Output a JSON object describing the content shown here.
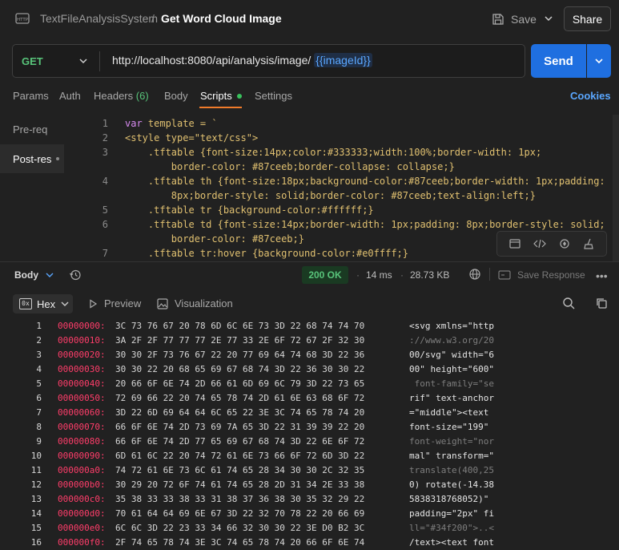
{
  "header": {
    "breadcrumb_parent": "TextFileAnalysisSystem",
    "breadcrumb_sep": "/",
    "title": "Get Word Cloud Image",
    "save_label": "Save",
    "share_label": "Share",
    "app_icon": "http-icon"
  },
  "request": {
    "method": "GET",
    "url": "http://localhost:8080/api/analysis/image/",
    "url_variable": "{{imageId}}",
    "send_label": "Send"
  },
  "tabs": {
    "params": "Params",
    "auth": "Auth",
    "headers": "Headers",
    "headers_count": "(6)",
    "body": "Body",
    "scripts": "Scripts",
    "settings": "Settings",
    "cookies": "Cookies"
  },
  "scripts": {
    "pre_request": "Pre-req",
    "post_response": "Post-res",
    "lines": [
      {
        "n": "1",
        "pre": "var",
        "text": " template = `"
      },
      {
        "n": "2",
        "pre": "",
        "text": "<style type=\"text/css\">"
      },
      {
        "n": "3",
        "pre": "",
        "text": "    .tftable {font-size:14px;color:#333333;width:100%;border-width: 1px;"
      },
      {
        "n": "",
        "pre": "",
        "text": "        border-color: #87ceeb;border-collapse: collapse;}"
      },
      {
        "n": "4",
        "pre": "",
        "text": "    .tftable th {font-size:18px;background-color:#87ceeb;border-width: 1px;padding:"
      },
      {
        "n": "",
        "pre": "",
        "text": "        8px;border-style: solid;border-color: #87ceeb;text-align:left;}"
      },
      {
        "n": "5",
        "pre": "",
        "text": "    .tftable tr {background-color:#ffffff;}"
      },
      {
        "n": "6",
        "pre": "",
        "text": "    .tftable td {font-size:14px;border-width: 1px;padding: 8px;border-style: solid;"
      },
      {
        "n": "",
        "pre": "",
        "text": "        border-color: #87ceeb;}"
      },
      {
        "n": "7",
        "pre": "",
        "text": "    .tftable tr:hover {background-color:#e0ffff;}"
      }
    ]
  },
  "response": {
    "body_label": "Body",
    "status": "200 OK",
    "time": "14 ms",
    "size": "28.73 KB",
    "save_response": "Save Response",
    "format": "Hex",
    "preview": "Preview",
    "visualization": "Visualization",
    "rows": [
      {
        "n": "1",
        "addr": "00000000:",
        "bytes": "3C 73 76 67 20 78 6D 6C 6E 73 3D 22 68 74 74 70",
        "ascii": "<svg xmlns=\"http",
        "dim": false
      },
      {
        "n": "2",
        "addr": "00000010:",
        "bytes": "3A 2F 2F 77 77 77 2E 77 33 2E 6F 72 67 2F 32 30",
        "ascii": "://www.w3.org/20",
        "dim": true
      },
      {
        "n": "3",
        "addr": "00000020:",
        "bytes": "30 30 2F 73 76 67 22 20 77 69 64 74 68 3D 22 36",
        "ascii": "00/svg\" width=\"6",
        "dim": false
      },
      {
        "n": "4",
        "addr": "00000030:",
        "bytes": "30 30 22 20 68 65 69 67 68 74 3D 22 36 30 30 22",
        "ascii": "00\" height=\"600\"",
        "dim": false
      },
      {
        "n": "5",
        "addr": "00000040:",
        "bytes": "20 66 6F 6E 74 2D 66 61 6D 69 6C 79 3D 22 73 65",
        "ascii": " font-family=\"se",
        "dim": true
      },
      {
        "n": "6",
        "addr": "00000050:",
        "bytes": "72 69 66 22 20 74 65 78 74 2D 61 6E 63 68 6F 72",
        "ascii": "rif\" text-anchor",
        "dim": false
      },
      {
        "n": "7",
        "addr": "00000060:",
        "bytes": "3D 22 6D 69 64 64 6C 65 22 3E 3C 74 65 78 74 20",
        "ascii": "=\"middle\"><text",
        "dim": false
      },
      {
        "n": "8",
        "addr": "00000070:",
        "bytes": "66 6F 6E 74 2D 73 69 7A 65 3D 22 31 39 39 22 20",
        "ascii": "font-size=\"199\"",
        "dim": false
      },
      {
        "n": "9",
        "addr": "00000080:",
        "bytes": "66 6F 6E 74 2D 77 65 69 67 68 74 3D 22 6E 6F 72",
        "ascii": "font-weight=\"nor",
        "dim": true
      },
      {
        "n": "10",
        "addr": "00000090:",
        "bytes": "6D 61 6C 22 20 74 72 61 6E 73 66 6F 72 6D 3D 22",
        "ascii": "mal\" transform=\"",
        "dim": false
      },
      {
        "n": "11",
        "addr": "000000a0:",
        "bytes": "74 72 61 6E 73 6C 61 74 65 28 34 30 30 2C 32 35",
        "ascii": "translate(400,25",
        "dim": true
      },
      {
        "n": "12",
        "addr": "000000b0:",
        "bytes": "30 29 20 72 6F 74 61 74 65 28 2D 31 34 2E 33 38",
        "ascii": "0) rotate(-14.38",
        "dim": false
      },
      {
        "n": "13",
        "addr": "000000c0:",
        "bytes": "35 38 33 33 38 33 31 38 37 36 38 30 35 32 29 22",
        "ascii": "5838318768052)\"",
        "dim": false
      },
      {
        "n": "14",
        "addr": "000000d0:",
        "bytes": "70 61 64 64 69 6E 67 3D 22 32 70 78 22 20 66 69",
        "ascii": "padding=\"2px\" fi",
        "dim": false
      },
      {
        "n": "15",
        "addr": "000000e0:",
        "bytes": "6C 6C 3D 22 23 33 34 66 32 30 30 22 3E D0 B2 3C",
        "ascii": "ll=\"#34f200\">..<",
        "dim": true
      },
      {
        "n": "16",
        "addr": "000000f0:",
        "bytes": "2F 74 65 78 74 3E 3C 74 65 78 74 20 66 6F 6E 74",
        "ascii": "/text><text font",
        "dim": false
      }
    ]
  },
  "colors": {
    "accent": "#1f6fe0",
    "method_get": "#58c47a",
    "status_ok": "#58c47a",
    "hex_address": "#ff3d6a",
    "tab_underline": "#f07b2a"
  }
}
